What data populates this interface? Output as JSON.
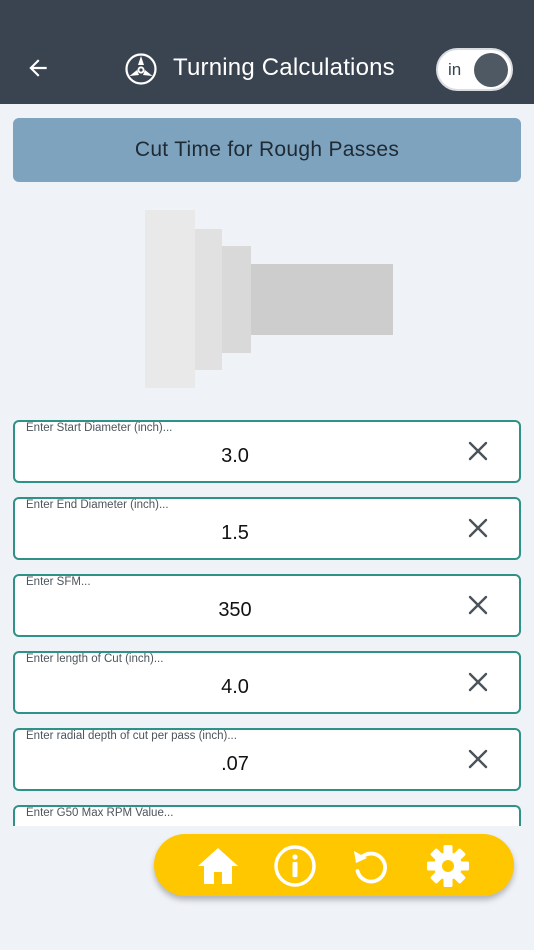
{
  "header": {
    "title": "Turning Calculations",
    "unit_toggle_label": "in"
  },
  "section": {
    "title": "Cut Time for Rough Passes"
  },
  "fields": [
    {
      "label": "Enter Start Diameter (inch)...",
      "value": "3.0"
    },
    {
      "label": "Enter End Diameter (inch)...",
      "value": "1.5"
    },
    {
      "label": "Enter SFM...",
      "value": "350"
    },
    {
      "label": "Enter length of Cut (inch)...",
      "value": "4.0"
    },
    {
      "label": "Enter radial depth of cut per pass (inch)...",
      "value": ".07"
    },
    {
      "label": "Enter G50 Max RPM Value...",
      "value": ""
    }
  ],
  "icons": {
    "back": "back-arrow-icon",
    "logo": "lathe-chuck-logo",
    "clear": "close-icon",
    "nav": [
      "home-icon",
      "info-icon",
      "refresh-icon",
      "gear-icon"
    ]
  },
  "colors": {
    "topbar": "#3a4450",
    "section_header": "#7ea3bf",
    "field_border": "#2f9287",
    "bottom_nav": "#ffc700",
    "background": "#eff2f7"
  }
}
